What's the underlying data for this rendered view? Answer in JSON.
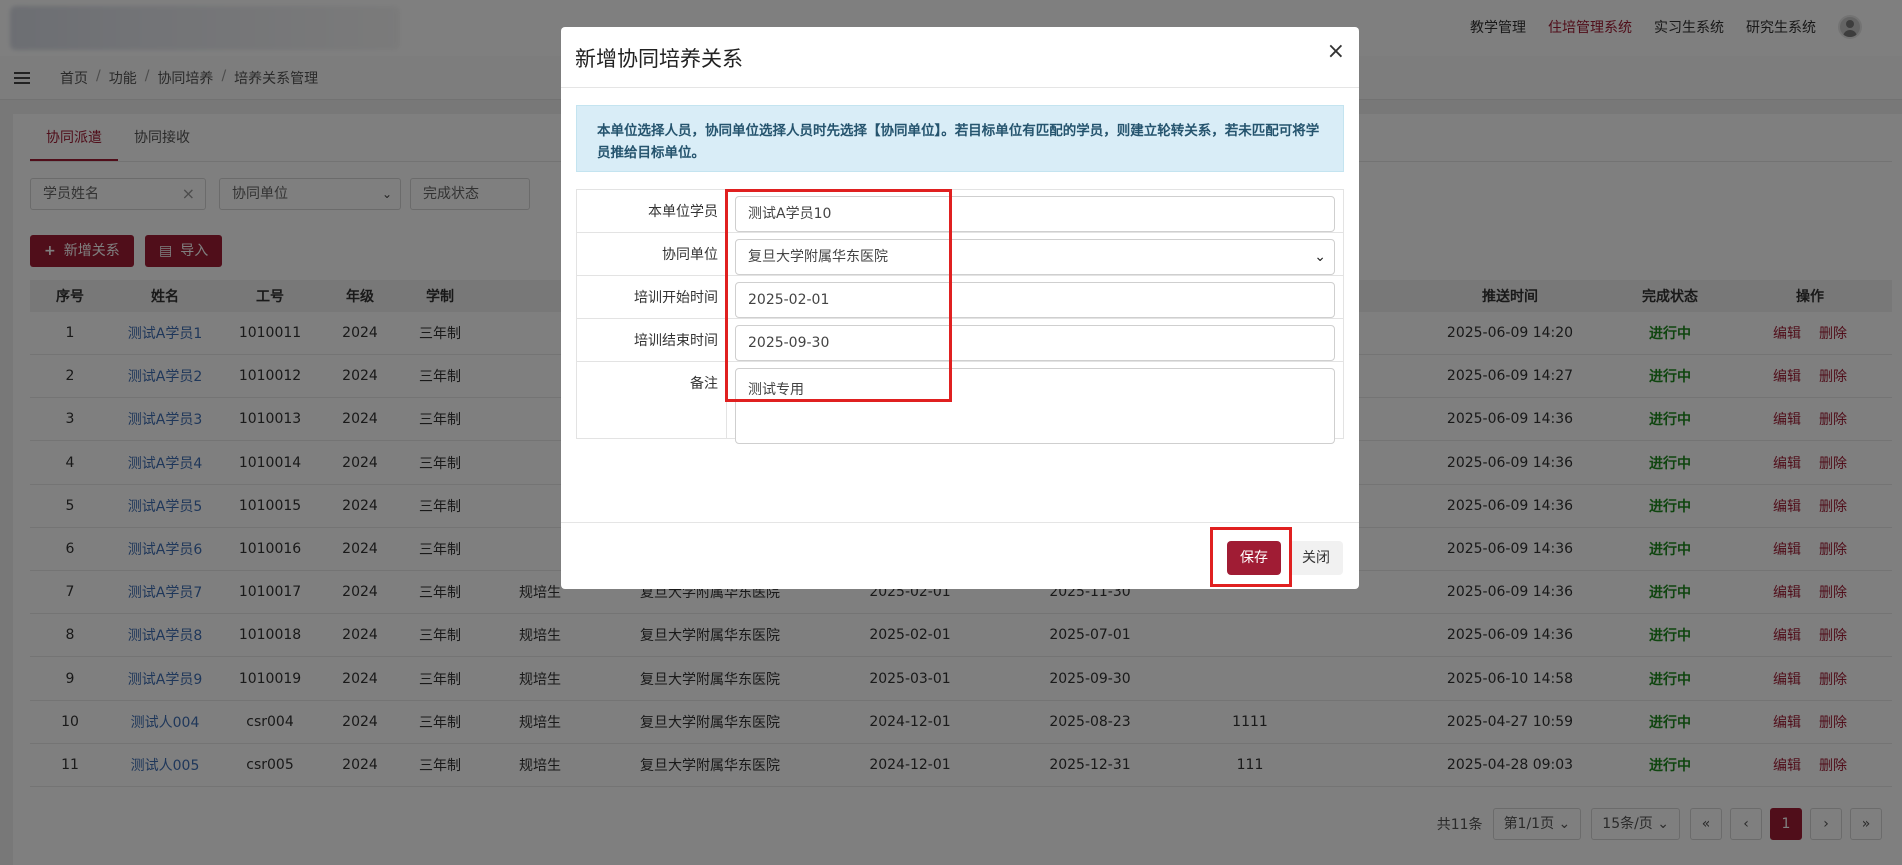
{
  "topnav": {
    "items": [
      "教学管理",
      "住培管理系统",
      "实习生系统",
      "研究生系统"
    ],
    "active_index": 1
  },
  "breadcrumb": [
    "首页",
    "功能",
    "协同培养",
    "培养关系管理"
  ],
  "tabs": [
    "协同派遣",
    "协同接收"
  ],
  "filters": {
    "student_name_placeholder": "学员姓名",
    "unit_select": "协同单位",
    "status_select": "完成状态"
  },
  "toolbar": {
    "add_label": "新增关系",
    "import_label": "导入"
  },
  "table": {
    "columns": [
      "序号",
      "姓名",
      "工号",
      "年级",
      "学制",
      "推送时间",
      "完成状态",
      "操作"
    ],
    "rows": [
      {
        "no": "1",
        "name": "测试A学员1",
        "id": "1010011",
        "grade": "2024",
        "system": "三年制",
        "type": "",
        "unit": "",
        "start": "",
        "end": "",
        "note": "",
        "push": "2025-06-09 14:20",
        "status": "进行中"
      },
      {
        "no": "2",
        "name": "测试A学员2",
        "id": "1010012",
        "grade": "2024",
        "system": "三年制",
        "type": "",
        "unit": "",
        "start": "",
        "end": "",
        "note": "",
        "push": "2025-06-09 14:27",
        "status": "进行中"
      },
      {
        "no": "3",
        "name": "测试A学员3",
        "id": "1010013",
        "grade": "2024",
        "system": "三年制",
        "type": "",
        "unit": "",
        "start": "",
        "end": "",
        "note": "",
        "push": "2025-06-09 14:36",
        "status": "进行中"
      },
      {
        "no": "4",
        "name": "测试A学员4",
        "id": "1010014",
        "grade": "2024",
        "system": "三年制",
        "type": "",
        "unit": "",
        "start": "",
        "end": "",
        "note": "",
        "push": "2025-06-09 14:36",
        "status": "进行中"
      },
      {
        "no": "5",
        "name": "测试A学员5",
        "id": "1010015",
        "grade": "2024",
        "system": "三年制",
        "type": "",
        "unit": "",
        "start": "",
        "end": "",
        "note": "",
        "push": "2025-06-09 14:36",
        "status": "进行中"
      },
      {
        "no": "6",
        "name": "测试A学员6",
        "id": "1010016",
        "grade": "2024",
        "system": "三年制",
        "type": "",
        "unit": "",
        "start": "",
        "end": "",
        "note": "",
        "push": "2025-06-09 14:36",
        "status": "进行中"
      },
      {
        "no": "7",
        "name": "测试A学员7",
        "id": "1010017",
        "grade": "2024",
        "system": "三年制",
        "type": "规培生",
        "unit": "复旦大学附属华东医院",
        "start": "2025-02-01",
        "end": "2025-11-30",
        "note": "",
        "push": "2025-06-09 14:36",
        "status": "进行中"
      },
      {
        "no": "8",
        "name": "测试A学员8",
        "id": "1010018",
        "grade": "2024",
        "system": "三年制",
        "type": "规培生",
        "unit": "复旦大学附属华东医院",
        "start": "2025-02-01",
        "end": "2025-07-01",
        "note": "",
        "push": "2025-06-09 14:36",
        "status": "进行中"
      },
      {
        "no": "9",
        "name": "测试A学员9",
        "id": "1010019",
        "grade": "2024",
        "system": "三年制",
        "type": "规培生",
        "unit": "复旦大学附属华东医院",
        "start": "2025-03-01",
        "end": "2025-09-30",
        "note": "",
        "push": "2025-06-10 14:58",
        "status": "进行中"
      },
      {
        "no": "10",
        "name": "测试人004",
        "id": "csr004",
        "grade": "2024",
        "system": "三年制",
        "type": "规培生",
        "unit": "复旦大学附属华东医院",
        "start": "2024-12-01",
        "end": "2025-08-23",
        "note": "1111",
        "push": "2025-04-27 10:59",
        "status": "进行中"
      },
      {
        "no": "11",
        "name": "测试人005",
        "id": "csr005",
        "grade": "2024",
        "system": "三年制",
        "type": "规培生",
        "unit": "复旦大学附属华东医院",
        "start": "2024-12-01",
        "end": "2025-12-31",
        "note": "111",
        "push": "2025-04-28 09:03",
        "status": "进行中"
      }
    ],
    "edit_label": "编辑",
    "delete_label": "删除"
  },
  "pagination": {
    "total": "共11条",
    "page_select": "第1/1页",
    "size_select": "15条/页",
    "first": "«",
    "prev": "‹",
    "current": "1",
    "next": "›",
    "last": "»"
  },
  "modal": {
    "title": "新增协同培养关系",
    "close_symbol": "×",
    "notice": "本单位选择人员，协同单位选择人员时先选择【协同单位】。若目标单位有匹配的学员，则建立轮转关系，若未匹配可将学员推给目标单位。",
    "fields": [
      {
        "label": "本单位学员",
        "value": "测试A学员10"
      },
      {
        "label": "协同单位",
        "value": "复旦大学附属华东医院"
      },
      {
        "label": "培训开始时间",
        "value": "2025-02-01"
      },
      {
        "label": "培训结束时间",
        "value": "2025-09-30"
      },
      {
        "label": "备注",
        "value": "测试专用"
      }
    ],
    "save_label": "保存",
    "close_label": "关闭"
  },
  "colors": {
    "brand": "#a01c34",
    "status_green": "#1e8a1e",
    "link_blue": "#3f6fb5",
    "highlight_red": "#e02020"
  }
}
